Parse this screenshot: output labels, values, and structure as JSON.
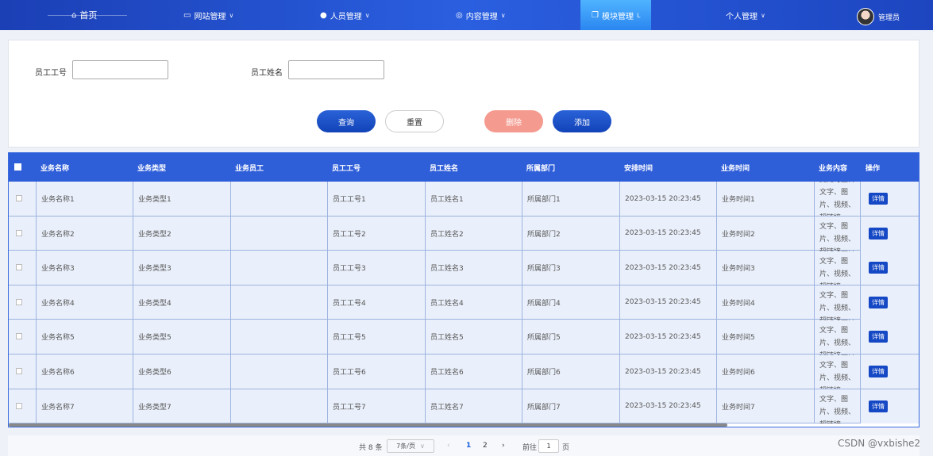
{
  "nav": {
    "home": "首页",
    "website": "网站管理",
    "staff": "人员管理",
    "content": "内容管理",
    "module": "模块管理",
    "personal": "个人管理",
    "user": "管理员"
  },
  "search": {
    "emp_no_label": "员工工号",
    "emp_name_label": "员工姓名",
    "emp_no_value": "",
    "emp_name_value": "",
    "query": "查询",
    "reset": "重置",
    "delete": "删除",
    "add": "添加"
  },
  "table": {
    "headers": [
      "业务名称",
      "业务类型",
      "业务员工",
      "员工工号",
      "员工姓名",
      "所属部门",
      "安排时间",
      "业务时间",
      "业务内容",
      "操作"
    ],
    "detail_label": "详情",
    "rows": [
      {
        "name": "业务名称1",
        "type": "业务类型1",
        "staff": "",
        "emp_no": "员工工号1",
        "emp_name": "员工姓名1",
        "dept": "所属部门1",
        "time": "2023-03-15 20:23:45",
        "biz_time": "业务时间1",
        "content": "此处可上传文字、图片、视频、超链接、..."
      },
      {
        "name": "业务名称2",
        "type": "业务类型2",
        "staff": "",
        "emp_no": "员工工号2",
        "emp_name": "员工姓名2",
        "dept": "所属部门2",
        "time": "2023-03-15 20:23:45",
        "biz_time": "业务时间2",
        "content": "此处可上传文字、图片、视频、超链接、..."
      },
      {
        "name": "业务名称3",
        "type": "业务类型3",
        "staff": "",
        "emp_no": "员工工号3",
        "emp_name": "员工姓名3",
        "dept": "所属部门3",
        "time": "2023-03-15 20:23:45",
        "biz_time": "业务时间3",
        "content": "此处可上传文字、图片、视频、超链接、..."
      },
      {
        "name": "业务名称4",
        "type": "业务类型4",
        "staff": "",
        "emp_no": "员工工号4",
        "emp_name": "员工姓名4",
        "dept": "所属部门4",
        "time": "2023-03-15 20:23:45",
        "biz_time": "业务时间4",
        "content": "此处可上传文字、图片、视频、超链接、..."
      },
      {
        "name": "业务名称5",
        "type": "业务类型5",
        "staff": "",
        "emp_no": "员工工号5",
        "emp_name": "员工姓名5",
        "dept": "所属部门5",
        "time": "2023-03-15 20:23:45",
        "biz_time": "业务时间5",
        "content": "此处可上传文字、图片、视频、超链接、..."
      },
      {
        "name": "业务名称6",
        "type": "业务类型6",
        "staff": "",
        "emp_no": "员工工号6",
        "emp_name": "员工姓名6",
        "dept": "所属部门6",
        "time": "2023-03-15 20:23:45",
        "biz_time": "业务时间6",
        "content": "此处可上传文字、图片、视频、超链接、..."
      },
      {
        "name": "业务名称7",
        "type": "业务类型7",
        "staff": "",
        "emp_no": "员工工号7",
        "emp_name": "员工姓名7",
        "dept": "所属部门7",
        "time": "2023-03-15 20:23:45",
        "biz_time": "业务时间7",
        "content": "此处可上传文字、图片、视频、超链接、..."
      }
    ]
  },
  "pager": {
    "total": "共 8 条",
    "page_size": "7条/页",
    "prev": "‹",
    "page1": "1",
    "page2": "2",
    "next": "›",
    "goto_label": "前往",
    "goto_value": "1",
    "page_suffix": "页"
  },
  "watermark": "CSDN @vxbishe2",
  "colors": {
    "nav_bg": "#2a5fe0",
    "header_bg": "#2f5ed9",
    "accent": "#1548c4",
    "delete": "#f59a8f"
  }
}
